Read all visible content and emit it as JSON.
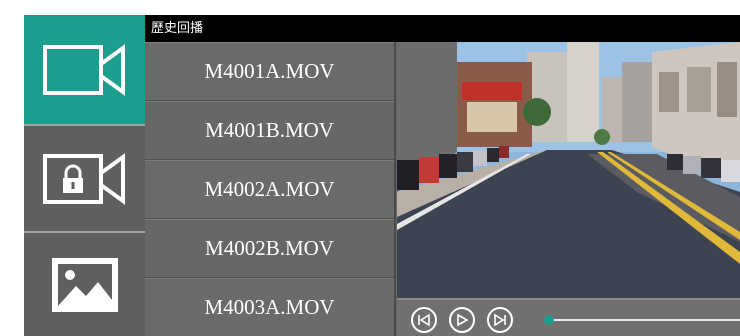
{
  "header": {
    "title": "歷史回播"
  },
  "sidebar": {
    "modes": [
      {
        "name": "video",
        "icon": "video-camera-icon",
        "active": true
      },
      {
        "name": "locked-video",
        "icon": "locked-video-icon",
        "active": false
      },
      {
        "name": "photo",
        "icon": "image-icon",
        "active": false
      }
    ]
  },
  "files": [
    {
      "name": "M4001A.MOV"
    },
    {
      "name": "M4001B.MOV"
    },
    {
      "name": "M4002A.MOV"
    },
    {
      "name": "M4002B.MOV"
    },
    {
      "name": "M4003A.MOV"
    }
  ],
  "player": {
    "controls": [
      "previous-icon",
      "play-icon",
      "next-icon"
    ],
    "progress": 0.0
  },
  "colors": {
    "accent": "#1d9d8e",
    "panel": "#6a6a6a",
    "titlebar": "#000000"
  }
}
